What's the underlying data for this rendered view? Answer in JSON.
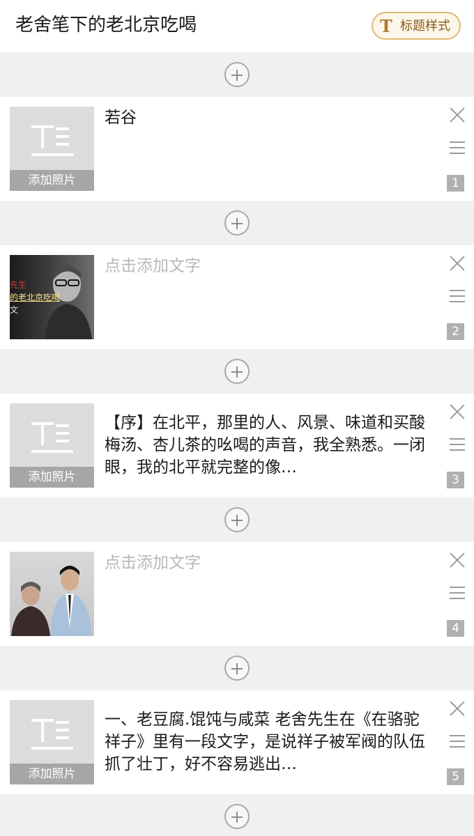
{
  "header": {
    "title": "老舍笔下的老北京吃喝",
    "style_button_icon": "T",
    "style_button_label": "标题样式"
  },
  "add_photo_label": "添加照片",
  "items": [
    {
      "text": "若谷",
      "number": "1",
      "type": "text-thumb"
    },
    {
      "text": "点击添加文字",
      "number": "2",
      "type": "photo",
      "photo_overlay": [
        "先生",
        "的老北京吃喝",
        "文"
      ]
    },
    {
      "text": "【序】在北平，那里的人、风景、味道和买酸梅汤、杏儿茶的吆喝的声音，我全熟悉。一闭眼，我的北平就完整的像…",
      "number": "3",
      "type": "text-thumb"
    },
    {
      "text": "点击添加文字",
      "number": "4",
      "type": "photo"
    },
    {
      "text": "一、老豆腐.馄饨与咸菜 老舍先生在《在骆驼祥子》里有一段文字，是说祥子被军阀的队伍抓了壮丁，好不容易逃出…",
      "number": "5",
      "type": "text-thumb"
    }
  ],
  "colors": {
    "accent": "#e0b877",
    "accent_text": "#8a5a18",
    "placeholder_text": "#b8b8b8",
    "badge": "#b0b0b0"
  },
  "icons": [
    "te-text-icon",
    "add-icon",
    "close-icon",
    "drag-handle-icon"
  ]
}
